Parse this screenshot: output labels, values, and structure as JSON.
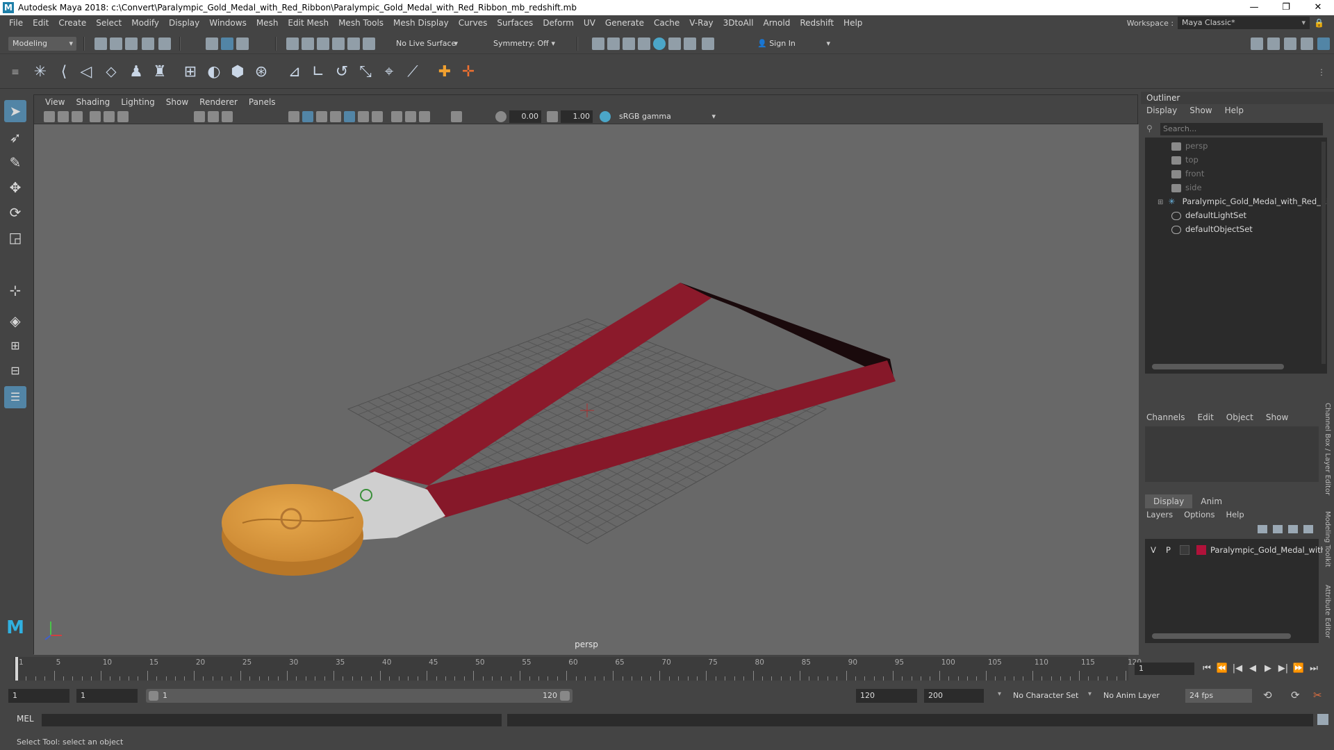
{
  "window": {
    "title": "Autodesk Maya 2018: c:\\Convert\\Paralympic_Gold_Medal_with_Red_Ribbon\\Paralympic_Gold_Medal_with_Red_Ribbon_mb_redshift.mb",
    "controls": [
      "—",
      "❐",
      "✕"
    ]
  },
  "menubar": {
    "items": [
      "File",
      "Edit",
      "Create",
      "Select",
      "Modify",
      "Display",
      "Windows",
      "Mesh",
      "Edit Mesh",
      "Mesh Tools",
      "Mesh Display",
      "Curves",
      "Surfaces",
      "Deform",
      "UV",
      "Generate",
      "Cache",
      "V-Ray",
      "3DtoAll",
      "Arnold",
      "Redshift",
      "Help"
    ],
    "workspace_label": "Workspace :",
    "workspace_value": "Maya Classic*"
  },
  "statusline": {
    "menuset": "Modeling",
    "live_surface": "No Live Surface",
    "symmetry": "Symmetry: Off",
    "sign_in": "Sign In"
  },
  "viewport": {
    "menu": [
      "View",
      "Shading",
      "Lighting",
      "Show",
      "Renderer",
      "Panels"
    ],
    "near_value": "0.00",
    "far_value": "1.00",
    "color_space": "sRGB gamma",
    "camera_label": "persp"
  },
  "outliner": {
    "title": "Outliner",
    "menu": [
      "Display",
      "Show",
      "Help"
    ],
    "search_placeholder": "Search...",
    "items": [
      {
        "label": "persp",
        "kind": "camera"
      },
      {
        "label": "top",
        "kind": "camera"
      },
      {
        "label": "front",
        "kind": "camera"
      },
      {
        "label": "side",
        "kind": "camera"
      },
      {
        "label": "Paralympic_Gold_Medal_with_Red_Ribbon",
        "kind": "group"
      },
      {
        "label": "defaultLightSet",
        "kind": "set"
      },
      {
        "label": "defaultObjectSet",
        "kind": "set"
      }
    ]
  },
  "channelbox": {
    "menu": [
      "Channels",
      "Edit",
      "Object",
      "Show"
    ]
  },
  "layereditor": {
    "tabs": [
      "Display",
      "Anim"
    ],
    "menu": [
      "Layers",
      "Options",
      "Help"
    ],
    "layer": {
      "v": "V",
      "p": "P",
      "name": "Paralympic_Gold_Medal_with_",
      "color": "#b0123a"
    }
  },
  "sidetabs": [
    "Channel Box / Layer Editor",
    "Modeling Toolkit",
    "Attribute Editor"
  ],
  "timeslider": {
    "labels": [
      "1",
      "5",
      "10",
      "15",
      "20",
      "25",
      "30",
      "35",
      "40",
      "45",
      "50",
      "55",
      "60",
      "65",
      "70",
      "75",
      "80",
      "85",
      "90",
      "95",
      "100",
      "105",
      "110",
      "115",
      "120"
    ],
    "current_frame": "1",
    "playback": [
      "⏮",
      "⏪",
      "|◀",
      "◀",
      "▶",
      "▶|",
      "⏩",
      "⏭"
    ]
  },
  "rangeslider": {
    "start": "1",
    "start_inner": "1",
    "range_start_label": "1",
    "range_end_label": "120",
    "end_inner": "120",
    "end": "200",
    "character_set": "No Character Set",
    "anim_layer": "No Anim Layer",
    "fps": "24 fps"
  },
  "cmdline": {
    "lang": "MEL"
  },
  "helpline": {
    "text": "Select Tool: select an object"
  },
  "colors": {
    "ribbon": "#8b1a2b",
    "medal": "#d9993e",
    "accent": "#5285a6"
  }
}
